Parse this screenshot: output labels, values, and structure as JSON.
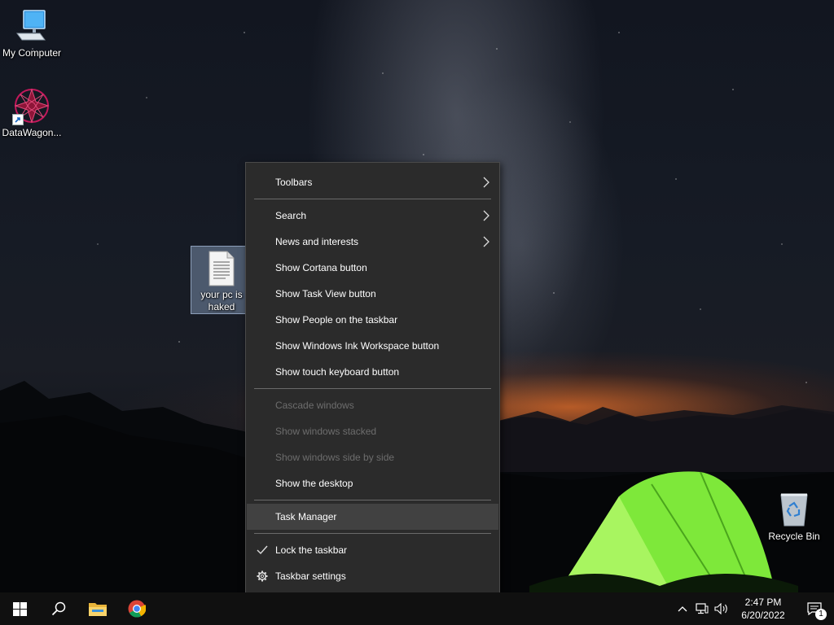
{
  "desktop": {
    "icons": [
      {
        "label": "My Computer",
        "icon": "computer-icon"
      },
      {
        "label": "DataWagon...",
        "icon": "datawagon-icon"
      },
      {
        "label": "your pc is haked",
        "icon": "text-file-icon"
      },
      {
        "label": "Recycle Bin",
        "icon": "recycle-bin-icon"
      }
    ]
  },
  "context_menu": {
    "items": [
      {
        "label": "Toolbars",
        "submenu": true,
        "enabled": true
      },
      {
        "label": "Search",
        "submenu": true,
        "enabled": true
      },
      {
        "label": "News and interests",
        "submenu": true,
        "enabled": true
      },
      {
        "label": "Show Cortana button",
        "enabled": true
      },
      {
        "label": "Show Task View button",
        "enabled": true
      },
      {
        "label": "Show People on the taskbar",
        "enabled": true
      },
      {
        "label": "Show Windows Ink Workspace button",
        "enabled": true
      },
      {
        "label": "Show touch keyboard button",
        "enabled": true
      },
      {
        "label": "Cascade windows",
        "enabled": false
      },
      {
        "label": "Show windows stacked",
        "enabled": false
      },
      {
        "label": "Show windows side by side",
        "enabled": false
      },
      {
        "label": "Show the desktop",
        "enabled": true
      },
      {
        "label": "Task Manager",
        "enabled": true,
        "highlighted": true
      },
      {
        "label": "Lock the taskbar",
        "enabled": true,
        "checked": true
      },
      {
        "label": "Taskbar settings",
        "enabled": true,
        "icon": "gear-icon"
      }
    ]
  },
  "taskbar": {
    "buttons": [
      {
        "icon": "windows-start-icon"
      },
      {
        "icon": "search-icon"
      },
      {
        "icon": "file-explorer-icon"
      },
      {
        "icon": "chrome-icon"
      }
    ],
    "tray": {
      "icons": [
        "chevron-up-icon",
        "network-icon",
        "volume-icon"
      ],
      "time": "2:47 PM",
      "date": "6/20/2022",
      "notification_count": "1"
    }
  },
  "colors": {
    "menu_bg": "#2b2b2b",
    "menu_highlight": "#414141",
    "menu_disabled_text": "#6d6d6d",
    "taskbar_bg": "#101010"
  }
}
